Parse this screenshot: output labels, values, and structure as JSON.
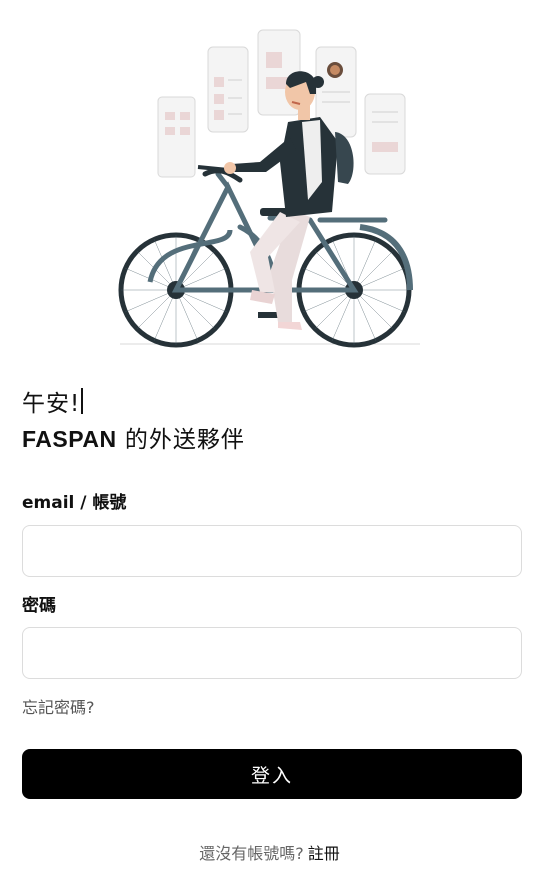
{
  "hero": {
    "alt_icon": "cyclist-illustration"
  },
  "greeting": {
    "text": "午安!"
  },
  "tagline": {
    "brand": "FASPAN",
    "rest": " 的外送夥伴"
  },
  "form": {
    "email_label": "email / 帳號",
    "email_value": "",
    "password_label": "密碼",
    "password_value": "",
    "forgot_link": "忘記密碼?",
    "submit_label": "登入"
  },
  "signup": {
    "prompt": "還沒有帳號嗎?",
    "link": "註冊"
  }
}
